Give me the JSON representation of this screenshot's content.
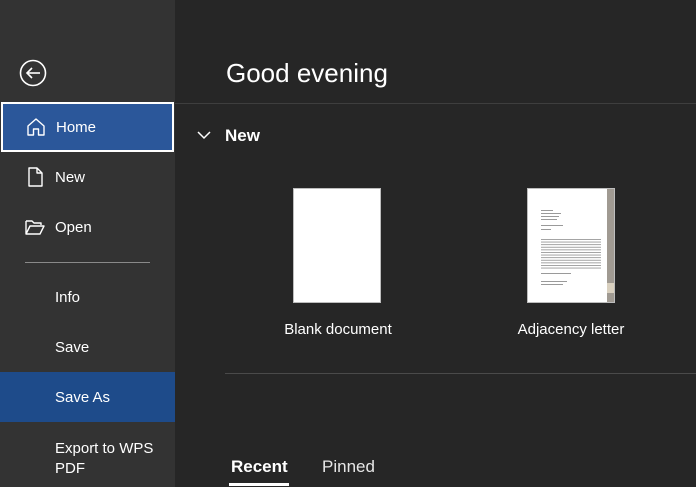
{
  "sidebar": {
    "items": [
      {
        "id": "home",
        "label": "Home",
        "icon": "home-icon"
      },
      {
        "id": "new",
        "label": "New",
        "icon": "new-document-icon"
      },
      {
        "id": "open",
        "label": "Open",
        "icon": "open-folder-icon"
      },
      {
        "id": "info",
        "label": "Info"
      },
      {
        "id": "save",
        "label": "Save"
      },
      {
        "id": "saveas",
        "label": "Save As"
      },
      {
        "id": "export",
        "label": "Export to WPS PDF"
      }
    ],
    "selected": "Home",
    "highlighted": "Save As"
  },
  "main": {
    "greeting": "Good evening",
    "new_section": {
      "title": "New",
      "templates": [
        {
          "label": "Blank document"
        },
        {
          "label": "Adjacency letter"
        }
      ]
    },
    "tabs": [
      {
        "label": "Recent",
        "active": true
      },
      {
        "label": "Pinned",
        "active": false
      }
    ]
  },
  "colors": {
    "sidebar_bg": "#333333",
    "main_bg": "#262626",
    "selected_bg": "#2b579a",
    "highlight_bg": "#1e4b8a"
  }
}
